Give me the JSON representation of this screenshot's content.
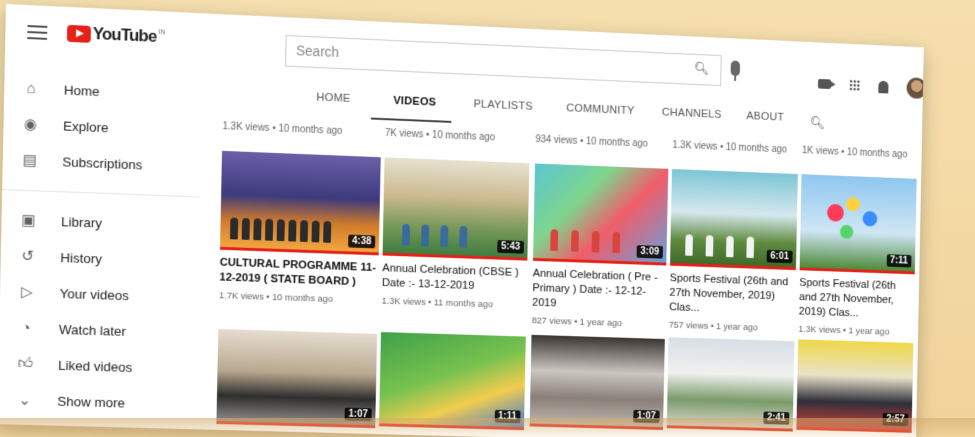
{
  "header": {
    "logo_text": "YouTube",
    "logo_region": "IN",
    "search_placeholder": "Search"
  },
  "sidebar": {
    "items": [
      {
        "label": "Home",
        "icon": "home-icon"
      },
      {
        "label": "Explore",
        "icon": "compass-icon"
      },
      {
        "label": "Subscriptions",
        "icon": "subscriptions-icon"
      },
      {
        "label": "Library",
        "icon": "library-icon"
      },
      {
        "label": "History",
        "icon": "history-icon"
      },
      {
        "label": "Your videos",
        "icon": "your-videos-icon"
      },
      {
        "label": "Watch later",
        "icon": "clock-icon"
      },
      {
        "label": "Liked videos",
        "icon": "thumbs-up-icon"
      },
      {
        "label": "Show more",
        "icon": "chevron-down-icon"
      }
    ]
  },
  "tabs": {
    "items": [
      "HOME",
      "VIDEOS",
      "PLAYLISTS",
      "COMMUNITY",
      "CHANNELS",
      "ABOUT"
    ],
    "active": "VIDEOS"
  },
  "prev_row_meta": [
    "1.3K views • 10 months ago",
    "7K views • 10 months ago",
    "934 views • 10 months ago",
    "1.3K views • 10 months ago",
    "1K views • 10 months ago"
  ],
  "videos_row1": [
    {
      "title": "CULTURAL PROGRAMME 11-12-2019 ( STATE BOARD )",
      "meta": "1.7K views • 10 months ago",
      "duration": "4:38"
    },
    {
      "title": "Annual Celebration (CBSE ) Date :- 13-12-2019",
      "meta": "1.3K views • 11 months ago",
      "duration": "5:43"
    },
    {
      "title": "Annual Celebration ( Pre - Primary ) Date :- 12-12-2019",
      "meta": "827 views • 1 year ago",
      "duration": "3:09"
    },
    {
      "title": "Sports Festival (26th and 27th November, 2019) Clas...",
      "meta": "757 views • 1 year ago",
      "duration": "6:01"
    },
    {
      "title": "Sports Festival (26th and 27th November, 2019) Clas...",
      "meta": "1.3K views • 1 year ago",
      "duration": "7:11"
    }
  ],
  "videos_row2": [
    {
      "duration": "1:07"
    },
    {
      "duration": "1:11"
    },
    {
      "duration": "1:07"
    },
    {
      "duration": "2:41"
    },
    {
      "duration": "2:57"
    }
  ],
  "colors": {
    "brand_red": "#e62117",
    "background_desk": "#f3d9a6"
  }
}
